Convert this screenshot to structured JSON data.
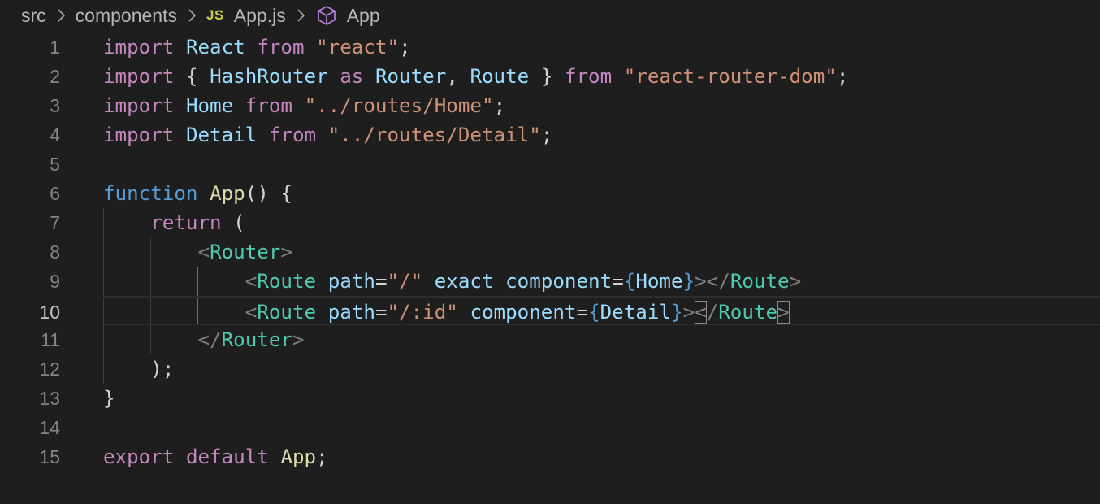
{
  "breadcrumb": {
    "segments": [
      "src",
      "components",
      "App.js",
      "App"
    ],
    "file_badge": "JS",
    "symbol_icon": "cube-icon"
  },
  "editor": {
    "line_numbers": [
      "1",
      "2",
      "3",
      "4",
      "5",
      "6",
      "7",
      "8",
      "9",
      "10",
      "11",
      "12",
      "13",
      "14",
      "15"
    ],
    "current_line": "10",
    "lines": [
      "import React from \"react\";",
      "import { HashRouter as Router, Route } from \"react-router-dom\";",
      "import Home from \"../routes/Home\";",
      "import Detail from \"../routes/Detail\";",
      "",
      "function App() {",
      "    return (",
      "        <Router>",
      "            <Route path=\"/\" exact component={Home}></Route>",
      "            <Route path=\"/:id\" component={Detail}></Route>",
      "        </Router>",
      "    );",
      "}",
      "",
      "export default App;"
    ]
  },
  "colors": {
    "background": "#1e1e1e",
    "keyword": "#c586c0",
    "string": "#ce9178",
    "variable": "#9cdcfe",
    "function": "#dcdcaa",
    "storage": "#569cd6",
    "tag": "#4ec9b0",
    "js_badge": "#cbcb41",
    "symbol_icon": "#b180d7"
  }
}
